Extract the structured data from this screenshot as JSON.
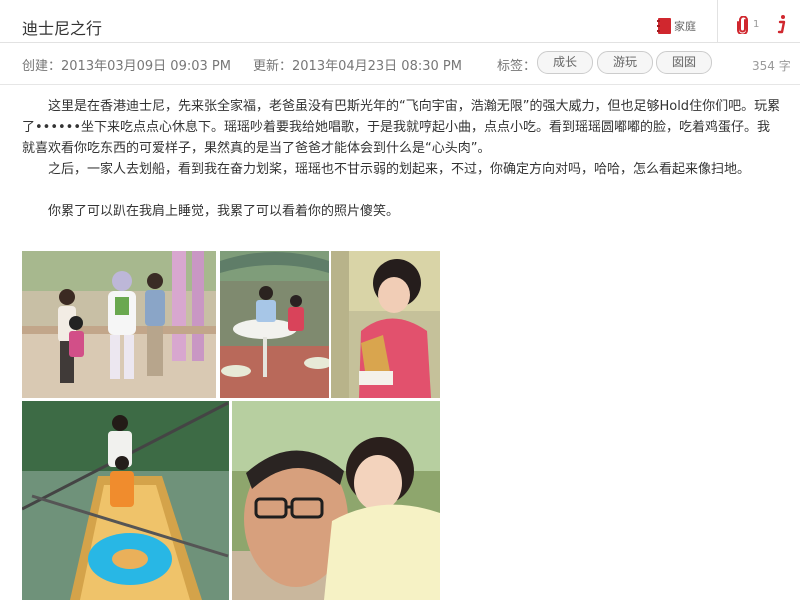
{
  "note": {
    "title": "迪士尼之行",
    "notebook": "家庭",
    "attachment_count": "1",
    "created": "创建：2013年03月09日  09:03 PM",
    "updated": "更新：2013年04月23日 08:30 PM",
    "tags_label": "标签：",
    "tags": [
      "成长",
      "游玩",
      "囡囡"
    ],
    "word_count": "354 字"
  },
  "content": {
    "paragraph_1": "这里是在香港迪士尼，先来张全家福，老爸虽没有巴斯光年的“飞向宇宙，浩瀚无限”的强大威力，但也足够Hold住你们吧。玩累了••••••坐下来吃点点心休息下。瑶瑶吵着要我给她唱歌，于是我就哼起小曲，点点小吃。看到瑶瑶圆嘟嘟的脸，吃着鸡蛋仔。我就喜欢看你吃东西的可爱样子，果然真的是当了爸爸才能体会到什么是“心头肉”。",
    "paragraph_2": "之后，一家人去划船，看到我在奋力划桨，瑶瑶也不甘示弱的划起来，不过，你确定方向对吗，哈哈，怎么看起来像扫地。",
    "paragraph_3": "你累了可以趴在我肩上睡觉，我累了可以看着你的照片傻笑。"
  },
  "colors": {
    "accent_red": "#d0272e",
    "border": "#e2e2e2",
    "meta_text": "#777777"
  },
  "icons": {
    "notebook": "notebook-icon",
    "attachment": "paperclip-icon",
    "info": "info-icon"
  }
}
